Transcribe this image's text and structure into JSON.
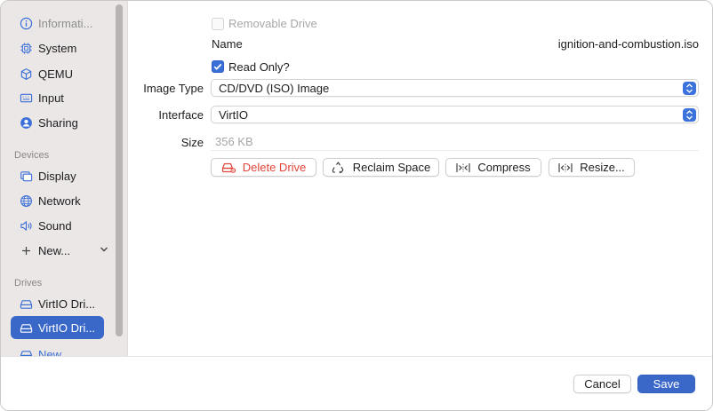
{
  "sidebar": {
    "items_top": [
      {
        "label": "Informati...",
        "icon": "info-circle-icon"
      },
      {
        "label": "System",
        "icon": "cpu-chip-icon"
      },
      {
        "label": "QEMU",
        "icon": "cube-icon"
      },
      {
        "label": "Input",
        "icon": "keyboard-icon"
      },
      {
        "label": "Sharing",
        "icon": "person-circle-icon"
      }
    ],
    "devices_header": "Devices",
    "devices": [
      {
        "label": "Display",
        "icon": "display-icon"
      },
      {
        "label": "Network",
        "icon": "network-globe-icon"
      },
      {
        "label": "Sound",
        "icon": "speaker-icon"
      },
      {
        "label": "New...",
        "icon": "plus-icon"
      }
    ],
    "drives_header": "Drives",
    "drives": [
      {
        "label": "VirtIO Dri...",
        "icon": "drive-icon"
      },
      {
        "label": "VirtIO Dri...",
        "icon": "drive-icon",
        "selected": true
      },
      {
        "label": "New...",
        "icon": "drive-icon"
      }
    ]
  },
  "main": {
    "removable_label": "Removable Drive",
    "removable_checked": false,
    "name_label": "Name",
    "name_value": "ignition-and-combustion.iso",
    "readonly_label": "Read Only?",
    "readonly_checked": true,
    "image_type_label": "Image Type",
    "image_type_value": "CD/DVD (ISO) Image",
    "interface_label": "Interface",
    "interface_value": "VirtIO",
    "size_label": "Size",
    "size_value": "356 KB",
    "buttons": {
      "delete": "Delete Drive",
      "reclaim": "Reclaim Space",
      "compress": "Compress",
      "resize": "Resize..."
    }
  },
  "footer": {
    "cancel": "Cancel",
    "save": "Save"
  },
  "colors": {
    "accent": "#3a68c9",
    "danger": "#e0443a",
    "sidebar_bg": "#ebe7e6"
  }
}
